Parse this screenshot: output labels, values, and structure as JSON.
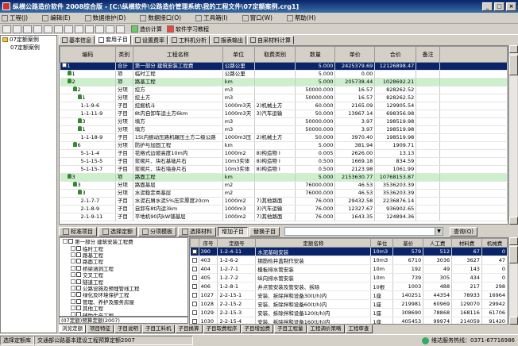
{
  "window": {
    "title": "纵横公路造价软件 2008综合版 - [C:\\纵横软件\\公路造价管理系统\\我的工程文件\\07定额案例.crg1]"
  },
  "menu": [
    {
      "label": "工程(J)"
    },
    {
      "label": "编辑(E)"
    },
    {
      "label": "数据维护(D)"
    },
    {
      "label": "数据接口(O)"
    },
    {
      "label": "工具箱(I)"
    },
    {
      "label": "窗口(W)"
    },
    {
      "label": "帮助(H)"
    }
  ],
  "toolbar": {
    "calc_label": "造价计算",
    "learn_label": "软件学习教程"
  },
  "project_tree": [
    {
      "label": "07定额案例"
    },
    {
      "label": "07定额案例"
    }
  ],
  "upper_tabs": [
    {
      "label": "基本信息"
    },
    {
      "label": "套用子目"
    },
    {
      "label": "设置费率"
    },
    {
      "label": "工料机分析"
    },
    {
      "label": "报表输出"
    },
    {
      "label": "自采材料计算"
    }
  ],
  "grid1": {
    "headers": [
      "编码",
      "类别",
      "工程名称",
      "单位",
      "取费类别",
      "数量",
      "单价",
      "合价",
      "备注"
    ],
    "rows": [
      {
        "code": "1",
        "type": "合计",
        "name": "第一部分 建筑安装工程费",
        "unit": "公路公里",
        "fee": "",
        "qty": "5.000",
        "price": "2425379.69",
        "total": "12126898.47",
        "note": "",
        "style": "sel",
        "icon": "box"
      },
      {
        "code": "1",
        "type": "项",
        "name": "临时工程",
        "unit": "公路公里",
        "fee": "",
        "qty": "5.000",
        "price": "0.00",
        "total": "",
        "note": "",
        "style": "",
        "icon": "person"
      },
      {
        "code": "2",
        "type": "项",
        "name": "路基工程",
        "unit": "km",
        "fee": "",
        "qty": "5.000",
        "price": "205738.44",
        "total": "1028692.21",
        "note": "",
        "style": "grn",
        "icon": "person"
      },
      {
        "code": "2",
        "type": "分项",
        "name": "挖方",
        "unit": "m3",
        "fee": "",
        "qty": "50000.000",
        "price": "16.57",
        "total": "828262.52",
        "note": "",
        "style": "",
        "icon": "person"
      },
      {
        "code": "1",
        "type": "分项",
        "name": "挖土方",
        "unit": "m3",
        "fee": "",
        "qty": "50000.000",
        "price": "16.57",
        "total": "828262.52",
        "note": "",
        "style": "",
        "icon": "person"
      },
      {
        "code": "1-1-9-6",
        "type": "子目",
        "name": "挖掘机斗",
        "unit": "1000m3天",
        "fee": "2)机械土方",
        "qty": "60.000",
        "price": "2165.09",
        "total": "129905.54",
        "note": "",
        "style": "",
        "icon": ""
      },
      {
        "code": "1-1-11-9",
        "type": "子目",
        "name": "8t内自卸车运土方6km",
        "unit": "1000m3天",
        "fee": "3)汽车运输",
        "qty": "50.000",
        "price": "13967.14",
        "total": "698356.98",
        "note": "",
        "style": "",
        "icon": ""
      },
      {
        "code": "3",
        "type": "分项",
        "name": "填方",
        "unit": "m3",
        "fee": "",
        "qty": "50000.000",
        "price": "3.97",
        "total": "198519.98",
        "note": "",
        "style": "",
        "icon": "person"
      },
      {
        "code": "1",
        "type": "分项",
        "name": "填方",
        "unit": "m3",
        "fee": "",
        "qty": "50000.000",
        "price": "3.97",
        "total": "198519.98",
        "note": "",
        "style": "",
        "icon": "person"
      },
      {
        "code": "1-1-18-9",
        "type": "子目",
        "name": "15t内振动压路机碾压土方二级公路",
        "unit": "1000m3压",
        "fee": "2)机械土方",
        "qty": "50.000",
        "price": "3970.40",
        "total": "198519.98",
        "note": "",
        "style": "",
        "icon": ""
      },
      {
        "code": "6",
        "type": "分项",
        "name": "防护与加固工程",
        "unit": "km",
        "fee": "",
        "qty": "5.000",
        "price": "381.94",
        "total": "1909.71",
        "note": "",
        "style": "",
        "icon": "person"
      },
      {
        "code": "5-1-1-4",
        "type": "子目",
        "name": "花格式边坡高度10m内",
        "unit": "1000m2",
        "fee": "8)构造物 I",
        "qty": "0.005",
        "price": "2626.00",
        "total": "13.13",
        "note": "",
        "style": "",
        "icon": ""
      },
      {
        "code": "5-1-15-5",
        "type": "子目",
        "name": "浆砌片、块石基础片石",
        "unit": "10m3实体",
        "fee": "8)构造物 I",
        "qty": "0.500",
        "price": "1669.18",
        "total": "834.59",
        "note": "",
        "style": "",
        "icon": ""
      },
      {
        "code": "5-1-15-7",
        "type": "子目",
        "name": "浆砌片、块石墙身片石",
        "unit": "10m3实体",
        "fee": "8)构造物 I",
        "qty": "0.500",
        "price": "2123.98",
        "total": "1061.99",
        "note": "",
        "style": "",
        "icon": ""
      },
      {
        "code": "3",
        "type": "项",
        "name": "路面工程",
        "unit": "km",
        "fee": "",
        "qty": "5.000",
        "price": "2153630.77",
        "total": "10768153.87",
        "note": "",
        "style": "grn",
        "icon": "person"
      },
      {
        "code": "3",
        "type": "分项",
        "name": "路面基层",
        "unit": "m2",
        "fee": "",
        "qty": "76000.000",
        "price": "46.53",
        "total": "3536203.39",
        "note": "",
        "style": "",
        "icon": "person"
      },
      {
        "code": "3",
        "type": "分项",
        "name": "水泥稳定类基层",
        "unit": "m2",
        "fee": "",
        "qty": "76000.000",
        "price": "46.53",
        "total": "3536203.39",
        "note": "",
        "style": "",
        "icon": "person"
      },
      {
        "code": "2-1-7-7",
        "type": "子目",
        "name": "水泥石屑水泥5%压实厚度20cm",
        "unit": "1000m2",
        "fee": "7)其他路面",
        "qty": "76.000",
        "price": "29432.58",
        "total": "2236876.14",
        "note": "",
        "style": "",
        "icon": ""
      },
      {
        "code": "2-1-8-9",
        "type": "子目",
        "name": "自卸车8t内运3km",
        "unit": "1000m3",
        "fee": "3)汽车运输",
        "qty": "76.000",
        "price": "12327.67",
        "total": "936902.65",
        "note": "",
        "style": "",
        "icon": ""
      },
      {
        "code": "2-1-9-11",
        "type": "子目",
        "name": "平地机90内kW铺基层",
        "unit": "1000m2",
        "fee": "7)其他路面",
        "qty": "76.000",
        "price": "1643.35",
        "total": "124894.36",
        "note": "",
        "style": "",
        "icon": ""
      }
    ]
  },
  "lower_toolbar": [
    {
      "label": "标准项目"
    },
    {
      "label": "选择定额"
    },
    {
      "label": "分项模板"
    },
    {
      "label": "选择材料"
    }
  ],
  "lower_actions": {
    "add_label": "增加子目",
    "replace_label": "替换子目",
    "query_label": "查询(Q)",
    "quota_select": ""
  },
  "quota_tree": [
    {
      "label": "第一部分 建筑安装工程费",
      "level": 0,
      "hi": false
    },
    {
      "label": "临时工程",
      "level": 1,
      "hi": false
    },
    {
      "label": "路基工程",
      "level": 1,
      "hi": false
    },
    {
      "label": "路面工程",
      "level": 1,
      "hi": false
    },
    {
      "label": "桥梁涵洞工程",
      "level": 1,
      "hi": false
    },
    {
      "label": "交叉工程",
      "level": 1,
      "hi": false
    },
    {
      "label": "隧道工程",
      "level": 1,
      "hi": false
    },
    {
      "label": "公路设施及预埋管线工程",
      "level": 1,
      "hi": false
    },
    {
      "label": "绿化及环境保护工程",
      "level": 1,
      "hi": false
    },
    {
      "label": "管理、养护及服务房屋",
      "level": 1,
      "hi": false
    },
    {
      "label": "其他工程",
      "level": 1,
      "hi": false
    },
    {
      "label": "辅助生产工程",
      "level": 1,
      "hi": false
    },
    {
      "label": "第二部分 设备及工具、器具购置费",
      "level": 0,
      "hi": false
    }
  ],
  "quota_tree_footer": "(07定额)预算定额(2007)",
  "grid2": {
    "headers": [
      "",
      "序号",
      "定额号",
      "定额名称",
      "单位",
      "基价",
      "人工费",
      "材料费",
      "机械费"
    ],
    "rows": [
      {
        "no": "390",
        "code": "1-2-4-11",
        "name": "水泥基础安装",
        "unit": "10m3",
        "base": "579",
        "labor": "512",
        "mat": "67",
        "mach": "0",
        "sel": true
      },
      {
        "no": "403",
        "code": "1-2-6-2",
        "name": "钢筋检井盖制作安装",
        "unit": "10m3",
        "base": "6710",
        "labor": "3036",
        "mat": "3627",
        "mach": "47",
        "sel": false
      },
      {
        "no": "404",
        "code": "1-2-7-1",
        "name": "模板排水管安装",
        "unit": "10m",
        "base": "192",
        "labor": "49",
        "mat": "143",
        "mach": "0",
        "sel": false
      },
      {
        "no": "405",
        "code": "1-2-7-2",
        "name": "纵向排水管安装",
        "unit": "10m",
        "base": "739",
        "labor": "305",
        "mat": "434",
        "mach": "0",
        "sel": false
      },
      {
        "no": "406",
        "code": "1-2-8-1",
        "name": "井点管安装及管安装、拆除",
        "unit": "10根",
        "base": "1003",
        "labor": "488",
        "mat": "217",
        "mach": "298",
        "sel": false
      },
      {
        "no": "1027",
        "code": "2-2-15-1",
        "name": "安装、拆除拌和设备30(t/h)内",
        "unit": "1座",
        "base": "140251",
        "labor": "44354",
        "mat": "78933",
        "mach": "16964",
        "sel": false
      },
      {
        "no": "1028",
        "code": "2-2-15-2",
        "name": "安装、拆除拌和设备60(t/h)内",
        "unit": "1座",
        "base": "219981",
        "labor": "60969",
        "mat": "129070",
        "mach": "29942",
        "sel": false
      },
      {
        "no": "1029",
        "code": "2-2-15-3",
        "name": "安装、拆除拌和设备120(t/h)内",
        "unit": "1座",
        "base": "308690",
        "labor": "78868",
        "mat": "168116",
        "mach": "61706",
        "sel": false
      },
      {
        "no": "1030",
        "code": "2-2-15-4",
        "name": "安装、拆除拌和设备160(t/h)内",
        "unit": "1座",
        "base": "405453",
        "labor": "99974",
        "mat": "214059",
        "mach": "91420",
        "sel": false
      },
      {
        "no": "1031",
        "code": "2-2-15-5",
        "name": "安装、拆除拌和设备240(t/h)内",
        "unit": "1座",
        "base": "518775",
        "labor": "123408",
        "mat": "273024",
        "mach": "122343",
        "sel": false
      }
    ]
  },
  "bottom_tabs": [
    {
      "label": "浏览定额",
      "active": true
    },
    {
      "label": "项目特征",
      "active": false
    },
    {
      "label": "子目说明",
      "active": false
    },
    {
      "label": "子目工料机",
      "active": false
    },
    {
      "label": "子目换算",
      "active": false
    },
    {
      "label": "子目取费程序",
      "active": false
    },
    {
      "label": "子目增加费",
      "active": false
    },
    {
      "label": "子目工程量",
      "active": false
    },
    {
      "label": "工程调价策略",
      "active": false
    },
    {
      "label": "工程审查",
      "active": false
    }
  ],
  "status": {
    "prefix": "选择定额库",
    "value": "交通部公路基本建设工程预算定额2007",
    "service": "维达服务热线：0371-67716986"
  }
}
